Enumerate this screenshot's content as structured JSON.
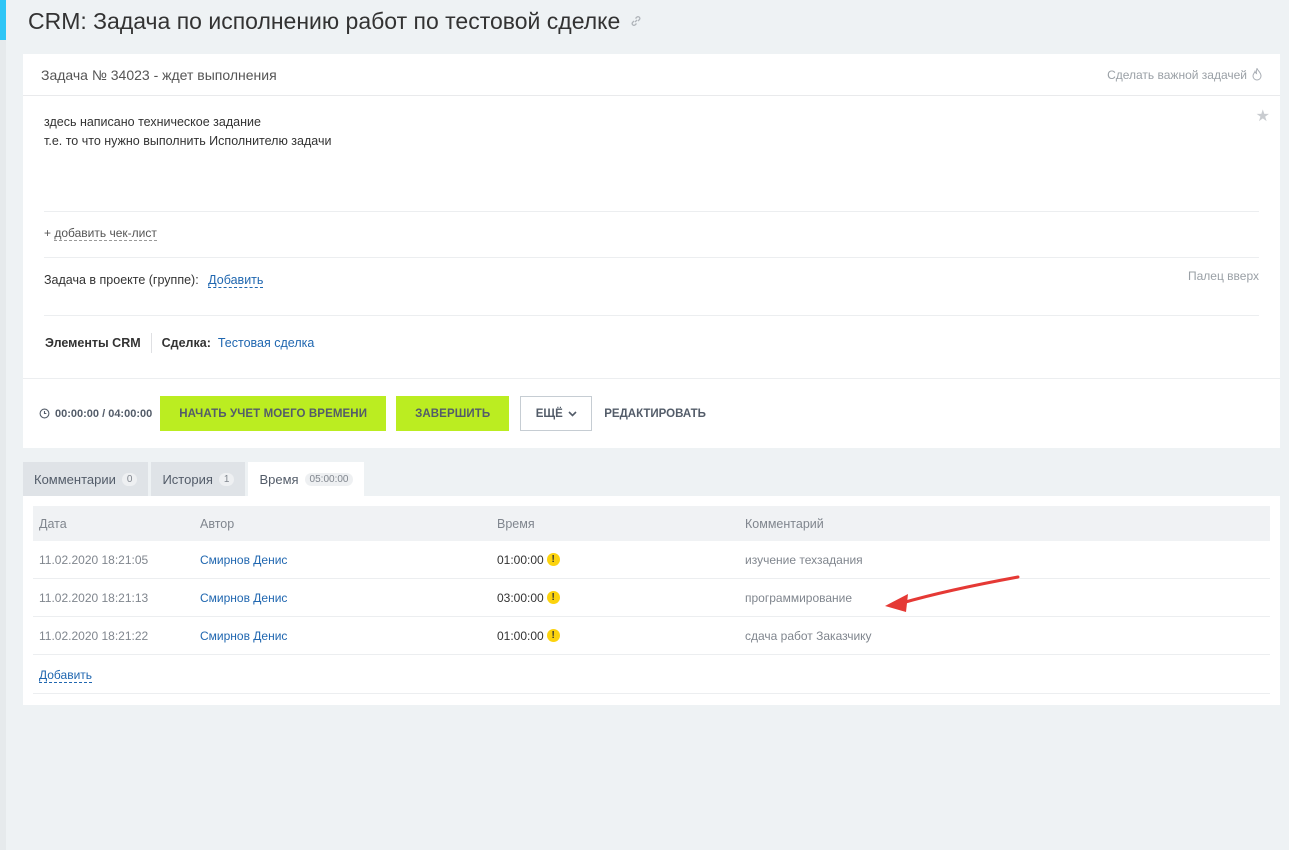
{
  "page": {
    "title": "CRM: Задача по исполнению работ по тестовой сделке"
  },
  "task": {
    "header": "Задача № 34023 - ждет выполнения",
    "make_important": "Сделать важной задачей",
    "description_lines": [
      "здесь написано техническое задание",
      "т.е. то что нужно выполнить Исполнителю задачи"
    ],
    "checklist_prefix": "+",
    "checklist_link": "добавить чек-лист",
    "project_label": "Задача в проекте (группе):",
    "project_add": "Добавить",
    "thumb_up": "Палец вверх",
    "crm_label": "Элементы CRM",
    "deal_label": "Сделка:",
    "deal_link": "Тестовая сделка"
  },
  "footer": {
    "timer": "00:00:00 / 04:00:00",
    "start_time_button": "НАЧАТЬ УЧЕТ МОЕГО ВРЕМЕНИ",
    "complete_button": "ЗАВЕРШИТЬ",
    "more_button": "ЕЩЁ",
    "edit_button": "РЕДАКТИРОВАТЬ"
  },
  "tabs": [
    {
      "label": "Комментарии",
      "count": "0"
    },
    {
      "label": "История",
      "count": "1"
    },
    {
      "label": "Время",
      "count": "05:00:00"
    }
  ],
  "time_table": {
    "headers": [
      "Дата",
      "Автор",
      "Время",
      "Комментарий"
    ],
    "rows": [
      {
        "date": "11.02.2020 18:21:05",
        "author": "Смирнов Денис",
        "time": "01:00:00",
        "comment": "изучение техзадания"
      },
      {
        "date": "11.02.2020 18:21:13",
        "author": "Смирнов Денис",
        "time": "03:00:00",
        "comment": "программирование"
      },
      {
        "date": "11.02.2020 18:21:22",
        "author": "Смирнов Денис",
        "time": "01:00:00",
        "comment": "сдача работ Заказчику"
      }
    ],
    "add_link": "Добавить"
  },
  "colors": {
    "accent_green": "#bbed21",
    "link_blue": "#2067b0",
    "warning_yellow": "#fcd30e",
    "annotation_arrow": "#e53935"
  }
}
